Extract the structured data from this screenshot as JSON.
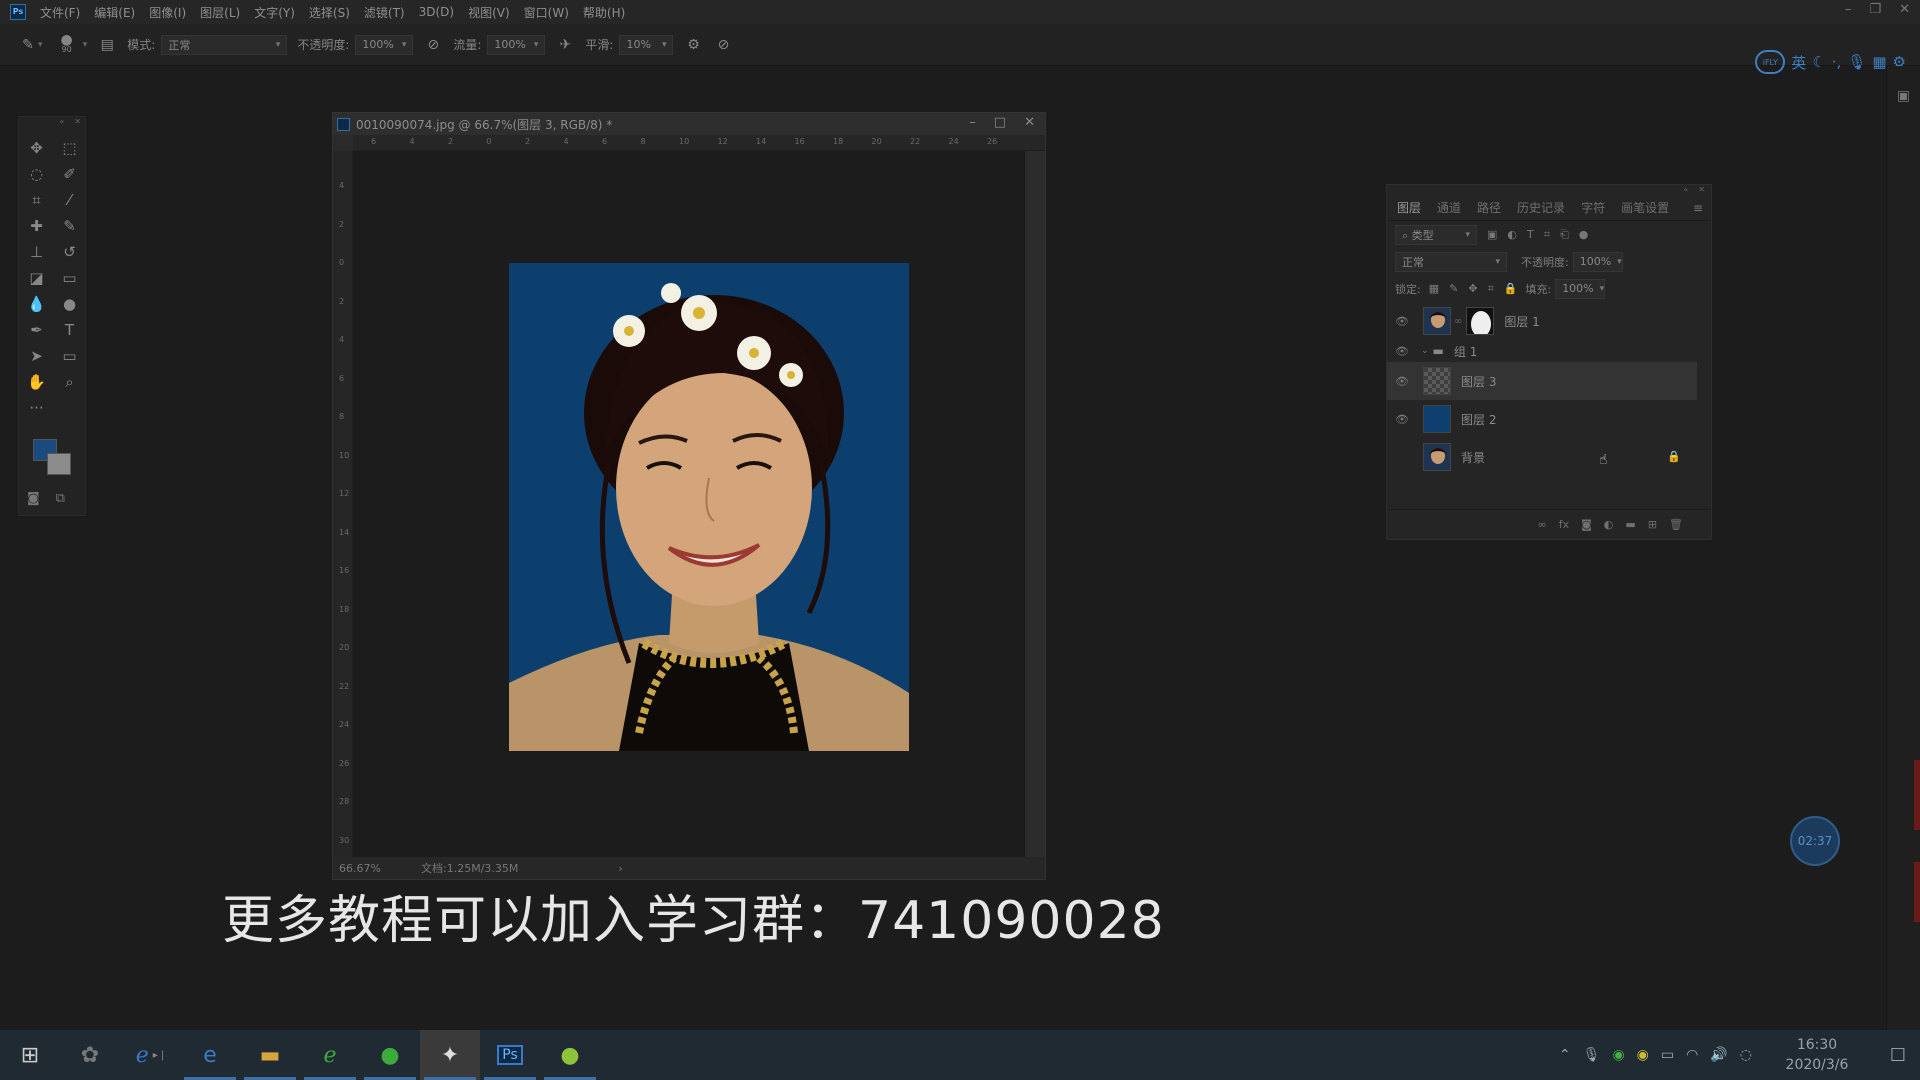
{
  "menubar": {
    "items": [
      "文件(F)",
      "编辑(E)",
      "图像(I)",
      "图层(L)",
      "文字(Y)",
      "选择(S)",
      "滤镜(T)",
      "3D(D)",
      "视图(V)",
      "窗口(W)",
      "帮助(H)"
    ]
  },
  "options": {
    "brush_size": "90",
    "mode_label": "模式:",
    "mode_value": "正常",
    "opacity_label": "不透明度:",
    "opacity_value": "100%",
    "flow_label": "流量:",
    "flow_value": "100%",
    "smooth_label": "平滑:",
    "smooth_value": "10%"
  },
  "ime": {
    "ifly": "iFLY",
    "lang": "英"
  },
  "document": {
    "title": "0010090074.jpg @ 66.7%(图层 3, RGB/8) *",
    "zoom": "66.67%",
    "docinfo": "文档:1.25M/3.35M",
    "ruler_top": [
      "6",
      "4",
      "2",
      "0",
      "2",
      "4",
      "6",
      "8",
      "10",
      "12",
      "14",
      "16",
      "18",
      "20",
      "22",
      "24",
      "26"
    ],
    "ruler_left": [
      "4",
      "2",
      "0",
      "2",
      "4",
      "6",
      "8",
      "10",
      "12",
      "14",
      "16",
      "18",
      "20",
      "22",
      "24",
      "26",
      "28",
      "30"
    ]
  },
  "layers_panel": {
    "tabs": [
      "图层",
      "通道",
      "路径",
      "历史记录",
      "字符",
      "画笔设置"
    ],
    "filter_kind": "类型",
    "blend_mode": "正常",
    "opacity_label": "不透明度:",
    "opacity_value": "100%",
    "lock_label": "锁定:",
    "fill_label": "填充:",
    "fill_value": "100%",
    "layers": [
      {
        "name": "图层 1",
        "type": "masked",
        "visible": true
      },
      {
        "name": "组 1",
        "type": "group",
        "visible": true
      },
      {
        "name": "图层 3",
        "type": "transparent",
        "visible": true,
        "selected": true
      },
      {
        "name": "图层 2",
        "type": "fill-blue",
        "visible": true
      },
      {
        "name": "背景",
        "type": "background",
        "visible": false,
        "locked": true
      }
    ]
  },
  "subtitle": "更多教程可以加入学习群：741090028",
  "timer": "02:37",
  "taskbar": {
    "time": "16:30",
    "date": "2020/3/6"
  },
  "colors": {
    "foreground": "#1b4b7c",
    "background": "#8c8c8c",
    "canvas_blue": "#0c3f6e"
  }
}
